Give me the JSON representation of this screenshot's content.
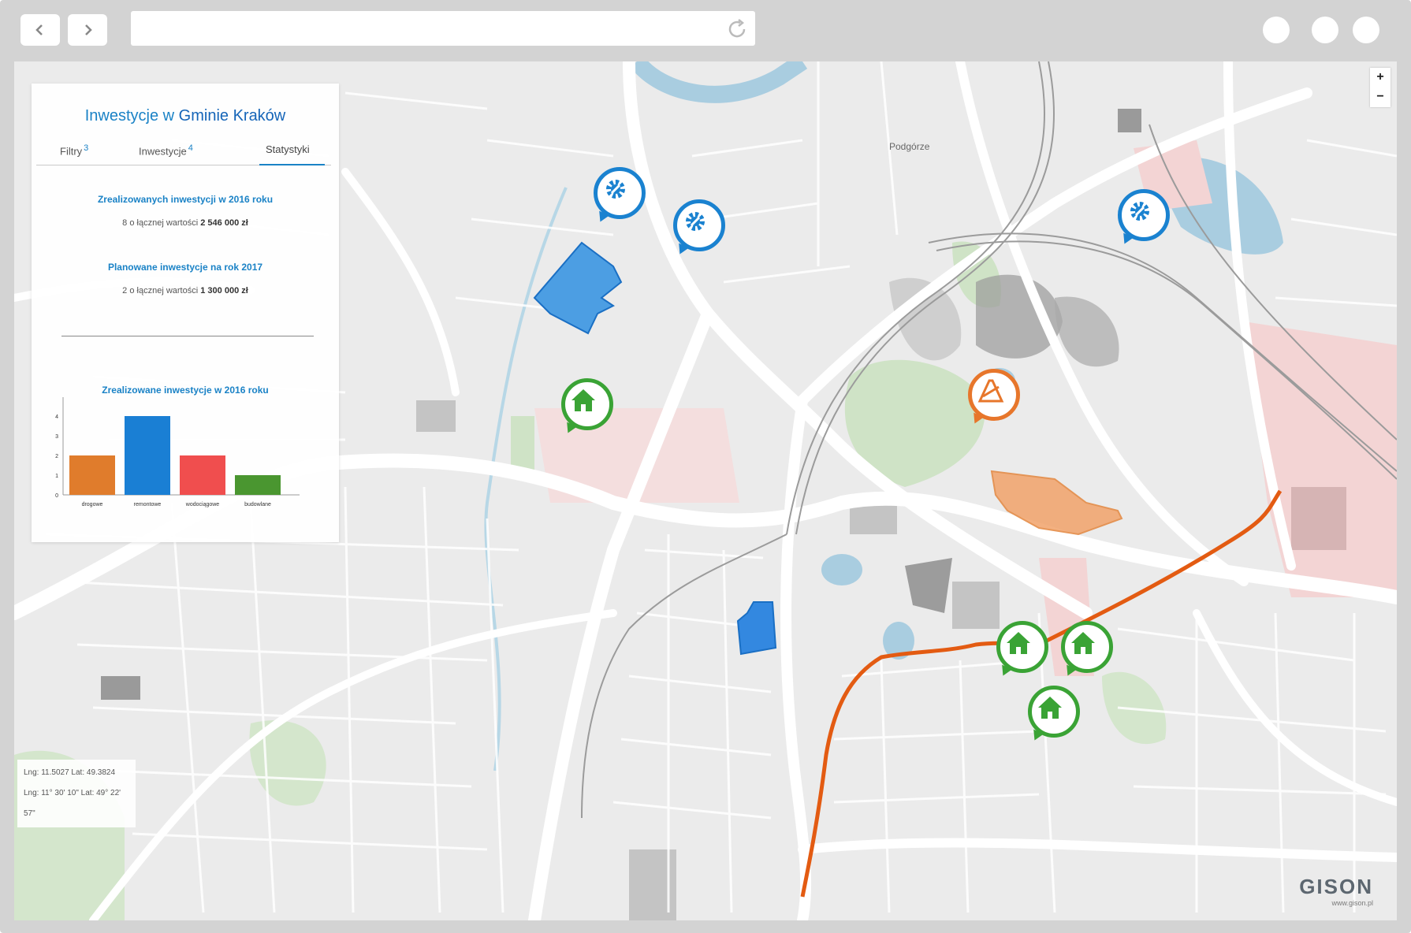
{
  "panel": {
    "title_prefix": "Inwestycje w",
    "title_strong": "Gminie Kraków",
    "tabs": [
      {
        "label": "Filtry",
        "count": "3"
      },
      {
        "label": "Inwestycje",
        "count": "4"
      },
      {
        "label": "Statystyki",
        "count": ""
      }
    ],
    "stats": [
      {
        "heading": "Zrealizowanych inwestycji w 2016 roku",
        "count": "8",
        "text": "o łącznej wartości",
        "value": "2 546 000 zł"
      },
      {
        "heading": "Planowane inwestycje na rok 2017",
        "count": "2",
        "text": "o łącznej wartości",
        "value": "1 300 000 zł"
      }
    ]
  },
  "chart_data": {
    "type": "bar",
    "title": "Zrealizowane inwestycje w 2016 roku",
    "categories": [
      "drogowe",
      "remontowe",
      "wodociągowe",
      "budowlane"
    ],
    "values": [
      2,
      4,
      2,
      1
    ],
    "colors": [
      "#e07c2c",
      "#1a7fd4",
      "#f04e4e",
      "#4a9630"
    ],
    "ylim": [
      0,
      4
    ],
    "yticks": [
      0,
      1,
      2,
      3,
      4
    ],
    "xlabel": "",
    "ylabel": "",
    "grid": false
  },
  "map": {
    "district_label": "Podgórze",
    "zoom_in": "+",
    "zoom_out": "−",
    "coords_decimal": "Lng: 11.5027 Lat: 49.3824",
    "coords_dms": "Lng: 11° 30' 10\" Lat: 49° 22' 57\"",
    "markers": [
      {
        "type": "service",
        "color": "#1a82d0",
        "icon": "gear-icon"
      },
      {
        "type": "service",
        "color": "#1a82d0",
        "icon": "gear-icon"
      },
      {
        "type": "service",
        "color": "#1a82d0",
        "icon": "gear-icon"
      },
      {
        "type": "building",
        "color": "#3aa335",
        "icon": "home-icon"
      },
      {
        "type": "road",
        "color": "#e7762b",
        "icon": "road-icon"
      },
      {
        "type": "building",
        "color": "#3aa335",
        "icon": "home-icon"
      },
      {
        "type": "building",
        "color": "#3aa335",
        "icon": "home-icon"
      },
      {
        "type": "building",
        "color": "#3aa335",
        "icon": "home-icon"
      }
    ]
  },
  "brand": {
    "name": "GISON",
    "url": "www.gison.pl"
  }
}
